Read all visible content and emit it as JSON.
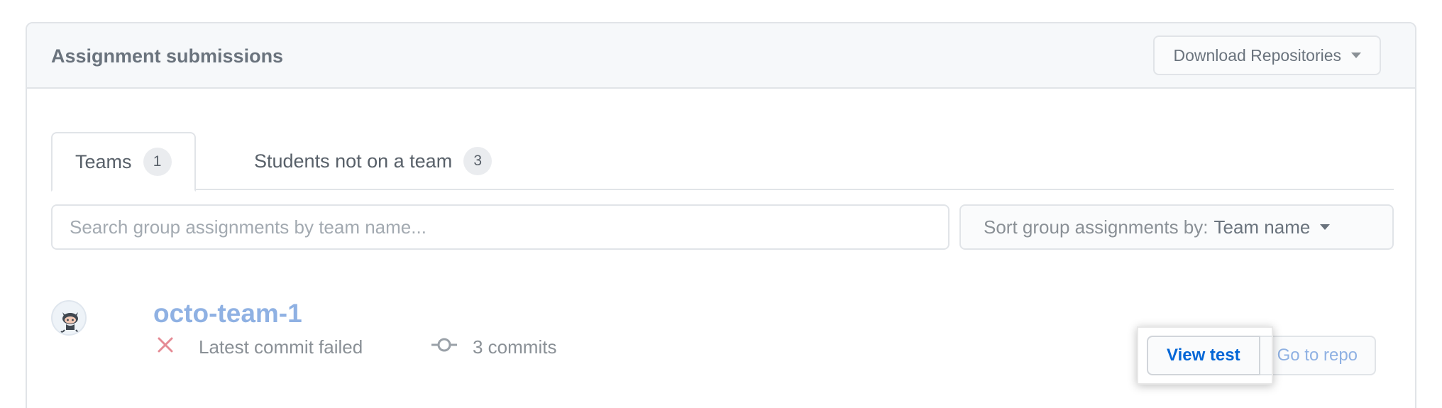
{
  "header": {
    "title": "Assignment submissions",
    "download_label": "Download Repositories"
  },
  "tabs": [
    {
      "label": "Teams",
      "count": "1",
      "active": true
    },
    {
      "label": "Students not on a team",
      "count": "3",
      "active": false
    }
  ],
  "search": {
    "placeholder": "Search group assignments by team name...",
    "value": ""
  },
  "sort": {
    "label": "Sort group assignments by:",
    "value": "Team name"
  },
  "team": {
    "name": "octo-team-1",
    "status": "Latest commit failed",
    "commits": "3 commits",
    "view_test_label": "View test",
    "go_to_repo_label": "Go to repo"
  },
  "icons": {
    "status": "x-icon",
    "commits": "git-commit-icon",
    "avatar": "octocat-avatar"
  },
  "colors": {
    "link": "#0366d6",
    "faded_link": "#8fb1e3",
    "error": "#d73a49"
  }
}
